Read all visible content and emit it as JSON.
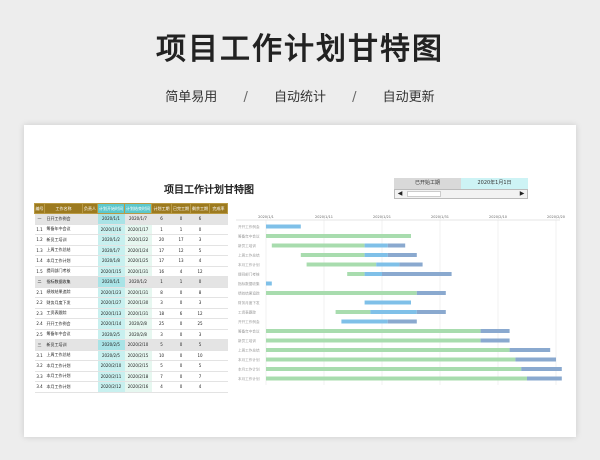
{
  "header": {
    "title": "项目工作计划甘特图",
    "features": [
      "简单易用",
      "自动统计",
      "自动更新"
    ],
    "separator": "/"
  },
  "sheet": {
    "title": "项目工作计划甘特图",
    "control": {
      "label": "已开始工期",
      "date": "2020年1月1日",
      "left_arrow": "◀",
      "right_arrow": "▶"
    },
    "columns": [
      "编号",
      "工作名称",
      "负责人",
      "计划开始时间",
      "计划结束时间",
      "计划工期",
      "已完工期",
      "剩余工期",
      "完成率"
    ],
    "rows": [
      {
        "id": "一",
        "name": "日开工作例会",
        "start": "2020/1/1",
        "end": "2020/1/7",
        "plan": "6",
        "done": "0",
        "rem": "6",
        "group": true
      },
      {
        "id": "1.1",
        "name": "筹备年中会议",
        "start": "2020/1/16",
        "end": "2020/1/17",
        "plan": "1",
        "done": "1",
        "rem": "0"
      },
      {
        "id": "1.2",
        "name": "新员工培训",
        "start": "2020/1/2",
        "end": "2020/1/22",
        "plan": "20",
        "done": "17",
        "rem": "3"
      },
      {
        "id": "1.3",
        "name": "上周工作总结",
        "start": "2020/1/7",
        "end": "2020/1/24",
        "plan": "17",
        "done": "12",
        "rem": "5"
      },
      {
        "id": "1.4",
        "name": "本月工作计划",
        "start": "2020/1/8",
        "end": "2020/1/25",
        "plan": "17",
        "done": "13",
        "rem": "4"
      },
      {
        "id": "1.5",
        "name": "提同部门考核",
        "start": "2020/1/15",
        "end": "2020/1/31",
        "plan": "16",
        "done": "4",
        "rem": "12"
      },
      {
        "id": "二",
        "name": "指标数据收集",
        "start": "2020/1/1",
        "end": "2020/1/2",
        "plan": "1",
        "done": "1",
        "rem": "0",
        "group": true
      },
      {
        "id": "2.1",
        "name": "绩效结果追踪",
        "start": "2020/1/23",
        "end": "2020/1/31",
        "plan": "8",
        "done": "0",
        "rem": "8"
      },
      {
        "id": "2.2",
        "name": "财务月度下发",
        "start": "2020/1/27",
        "end": "2020/1/30",
        "plan": "3",
        "done": "0",
        "rem": "3"
      },
      {
        "id": "2.3",
        "name": "工资表跟踪",
        "start": "2020/1/13",
        "end": "2020/1/31",
        "plan": "18",
        "done": "6",
        "rem": "12"
      },
      {
        "id": "2.4",
        "name": "开开工作例会",
        "start": "2020/1/14",
        "end": "2020/2/8",
        "plan": "25",
        "done": "0",
        "rem": "25"
      },
      {
        "id": "2.5",
        "name": "筹备年中会议",
        "start": "2020/2/5",
        "end": "2020/2/8",
        "plan": "3",
        "done": "0",
        "rem": "3"
      },
      {
        "id": "三",
        "name": "新员工培训",
        "start": "2020/2/5",
        "end": "2020/2/10",
        "plan": "5",
        "done": "0",
        "rem": "5",
        "group": true
      },
      {
        "id": "3.1",
        "name": "上周工作总结",
        "start": "2020/2/5",
        "end": "2020/2/15",
        "plan": "10",
        "done": "0",
        "rem": "10"
      },
      {
        "id": "3.2",
        "name": "本月工作计划",
        "start": "2020/2/10",
        "end": "2020/2/15",
        "plan": "5",
        "done": "0",
        "rem": "5"
      },
      {
        "id": "3.3",
        "name": "本月工作计划",
        "start": "2020/2/11",
        "end": "2020/2/18",
        "plan": "7",
        "done": "0",
        "rem": "7"
      },
      {
        "id": "3.4",
        "name": "本月工作计划",
        "start": "2020/2/12",
        "end": "2020/2/16",
        "plan": "4",
        "done": "0",
        "rem": "4"
      }
    ]
  },
  "chart_data": {
    "type": "bar",
    "orientation": "horizontal-stacked",
    "x_ticks": [
      "2020/1/1",
      "2020/1/11",
      "2020/1/21",
      "2020/1/31",
      "2020/2/10",
      "2020/2/20"
    ],
    "x_range_days": [
      0,
      50
    ],
    "categories": [
      "开开工作例会",
      "筹备年中会议",
      "新员工培训",
      "上周工作总结",
      "本月工作计划",
      "提同部门考核",
      "指标数据收集",
      "绩效结果追踪",
      "财务月度下发",
      "工资表跟踪",
      "开开工作例会",
      "筹备年中会议",
      "新员工培训",
      "上周工作总结",
      "本月工作计划",
      "本月工作计划",
      "本月工作计划"
    ],
    "start_offset_days": [
      0,
      0,
      1,
      6,
      7,
      14,
      0,
      0,
      17,
      12,
      13,
      0,
      0,
      0,
      0,
      0,
      0
    ],
    "series": [
      {
        "color": "#a8dcae",
        "values": [
          0,
          25,
          16,
          11,
          12,
          3,
          0,
          26,
          0,
          6,
          0,
          37,
          37,
          42,
          43,
          44,
          45
        ]
      },
      {
        "color": "#7fc0e8",
        "values": [
          6,
          0,
          4,
          4,
          4,
          3,
          1,
          0,
          8,
          8,
          8,
          0,
          0,
          0,
          0,
          0,
          0
        ]
      },
      {
        "color": "#8aa9cf",
        "values": [
          0,
          0,
          3,
          5,
          4,
          12,
          0,
          5,
          0,
          5,
          5,
          5,
          5,
          7,
          7,
          7,
          6
        ]
      }
    ],
    "grid": true
  }
}
